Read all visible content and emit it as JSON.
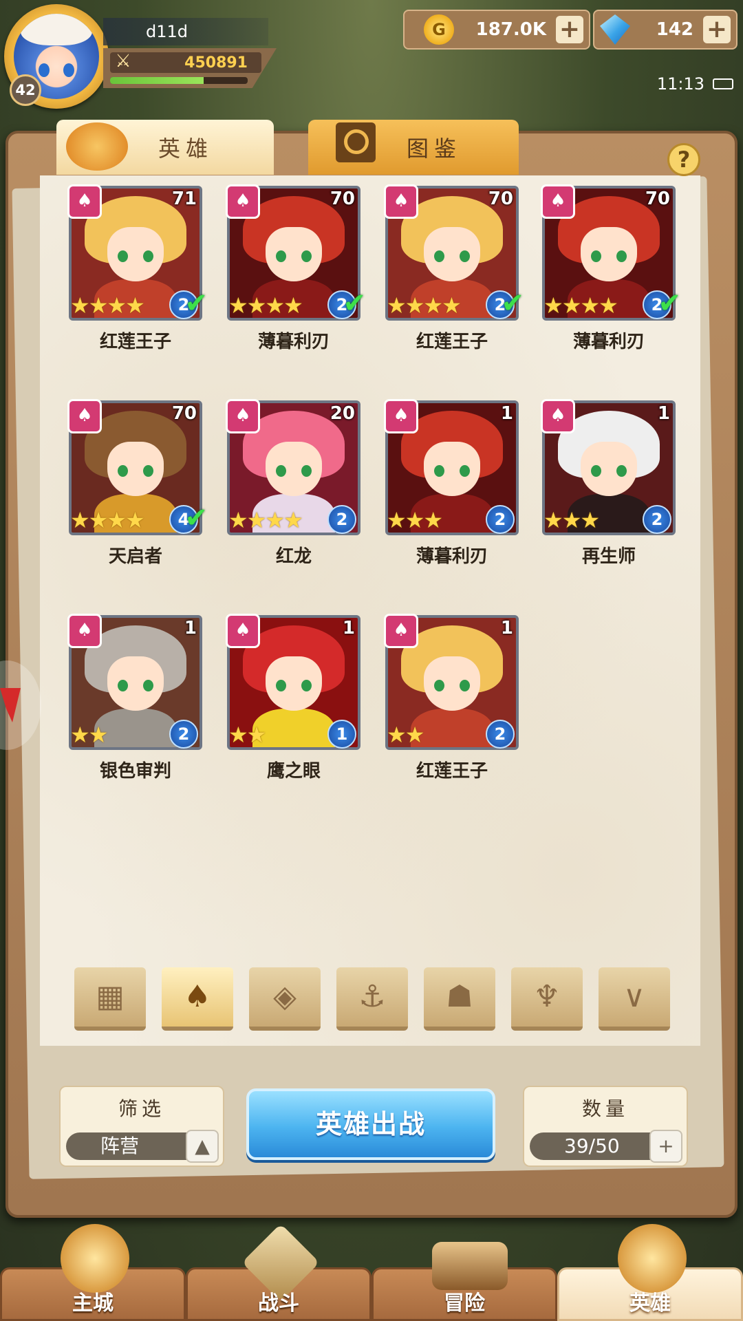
{
  "player": {
    "name": "d11d",
    "level": "42",
    "power": "450891",
    "exp_fraction": 0.68
  },
  "currencies": {
    "gold": {
      "value": "187.0K",
      "icon": "gold-coin-icon"
    },
    "gems": {
      "value": "142",
      "icon": "diamond-icon"
    }
  },
  "status": {
    "time": "11:13"
  },
  "tabs": [
    {
      "label": "英雄",
      "active": true
    },
    {
      "label": "图鉴",
      "active": false
    }
  ],
  "heroes": [
    {
      "name": "红莲王子",
      "level": "71",
      "stars": 4,
      "rank": "2",
      "check": true,
      "theme": "blonde"
    },
    {
      "name": "薄暮利刃",
      "level": "70",
      "stars": 4,
      "rank": "2",
      "check": true,
      "theme": "redhood"
    },
    {
      "name": "红莲王子",
      "level": "70",
      "stars": 4,
      "rank": "2",
      "check": true,
      "theme": "blonde"
    },
    {
      "name": "薄暮利刃",
      "level": "70",
      "stars": 4,
      "rank": "2",
      "check": true,
      "theme": "redhood"
    },
    {
      "name": "天启者",
      "level": "70",
      "stars": 4,
      "rank": "4",
      "check": true,
      "theme": "crown"
    },
    {
      "name": "红龙",
      "level": "20",
      "stars": 4,
      "rank": "2",
      "check": false,
      "theme": "pink"
    },
    {
      "name": "薄暮利刃",
      "level": "1",
      "stars": 3,
      "rank": "2",
      "check": false,
      "theme": "redhood"
    },
    {
      "name": "再生师",
      "level": "1",
      "stars": 3,
      "rank": "2",
      "check": false,
      "theme": "white"
    },
    {
      "name": "银色审判",
      "level": "1",
      "stars": 2,
      "rank": "2",
      "check": false,
      "theme": "knight"
    },
    {
      "name": "鹰之眼",
      "level": "1",
      "stars": 2,
      "rank": "1",
      "check": false,
      "theme": "bird"
    },
    {
      "name": "红莲王子",
      "level": "1",
      "stars": 2,
      "rank": "2",
      "check": false,
      "theme": "blonde"
    }
  ],
  "faction_filters": [
    {
      "icon": "grid-all-icon",
      "glyph": "▦",
      "active": false
    },
    {
      "icon": "flame-faction-icon",
      "glyph": "♠",
      "active": true
    },
    {
      "icon": "diamond-faction-icon",
      "glyph": "◈",
      "active": false
    },
    {
      "icon": "anchor-faction-icon",
      "glyph": "⚓",
      "active": false
    },
    {
      "icon": "beast-faction-icon",
      "glyph": "☗",
      "active": false
    },
    {
      "icon": "demon-faction-icon",
      "glyph": "♆",
      "active": false
    },
    {
      "icon": "wing-faction-icon",
      "glyph": "∨",
      "active": false
    }
  ],
  "filter": {
    "title": "筛选",
    "value": "阵营"
  },
  "deploy": {
    "label": "英雄出战"
  },
  "count": {
    "title": "数量",
    "value": "39/50"
  },
  "nav": [
    {
      "label": "主城",
      "active": false
    },
    {
      "label": "战斗",
      "active": false
    },
    {
      "label": "冒险",
      "active": false
    },
    {
      "label": "英雄",
      "active": true
    }
  ]
}
